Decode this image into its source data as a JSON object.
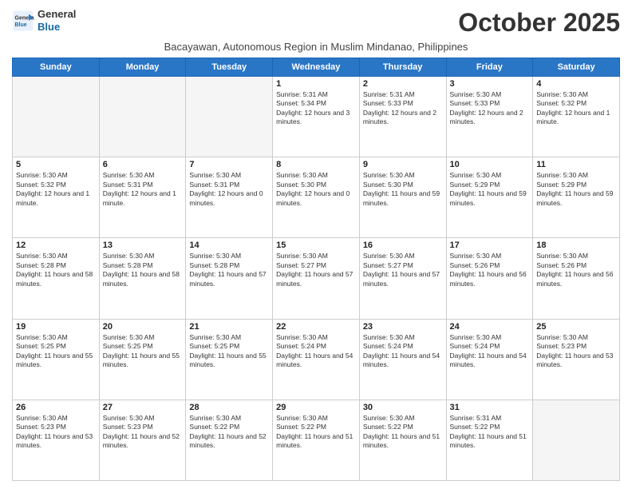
{
  "logo": {
    "line1": "General",
    "line2": "Blue"
  },
  "title": "October 2025",
  "subtitle": "Bacayawan, Autonomous Region in Muslim Mindanao, Philippines",
  "days_of_week": [
    "Sunday",
    "Monday",
    "Tuesday",
    "Wednesday",
    "Thursday",
    "Friday",
    "Saturday"
  ],
  "weeks": [
    [
      {
        "day": "",
        "info": ""
      },
      {
        "day": "",
        "info": ""
      },
      {
        "day": "",
        "info": ""
      },
      {
        "day": "1",
        "info": "Sunrise: 5:31 AM\nSunset: 5:34 PM\nDaylight: 12 hours and 3 minutes."
      },
      {
        "day": "2",
        "info": "Sunrise: 5:31 AM\nSunset: 5:33 PM\nDaylight: 12 hours and 2 minutes."
      },
      {
        "day": "3",
        "info": "Sunrise: 5:30 AM\nSunset: 5:33 PM\nDaylight: 12 hours and 2 minutes."
      },
      {
        "day": "4",
        "info": "Sunrise: 5:30 AM\nSunset: 5:32 PM\nDaylight: 12 hours and 1 minute."
      }
    ],
    [
      {
        "day": "5",
        "info": "Sunrise: 5:30 AM\nSunset: 5:32 PM\nDaylight: 12 hours and 1 minute."
      },
      {
        "day": "6",
        "info": "Sunrise: 5:30 AM\nSunset: 5:31 PM\nDaylight: 12 hours and 1 minute."
      },
      {
        "day": "7",
        "info": "Sunrise: 5:30 AM\nSunset: 5:31 PM\nDaylight: 12 hours and 0 minutes."
      },
      {
        "day": "8",
        "info": "Sunrise: 5:30 AM\nSunset: 5:30 PM\nDaylight: 12 hours and 0 minutes."
      },
      {
        "day": "9",
        "info": "Sunrise: 5:30 AM\nSunset: 5:30 PM\nDaylight: 11 hours and 59 minutes."
      },
      {
        "day": "10",
        "info": "Sunrise: 5:30 AM\nSunset: 5:29 PM\nDaylight: 11 hours and 59 minutes."
      },
      {
        "day": "11",
        "info": "Sunrise: 5:30 AM\nSunset: 5:29 PM\nDaylight: 11 hours and 59 minutes."
      }
    ],
    [
      {
        "day": "12",
        "info": "Sunrise: 5:30 AM\nSunset: 5:28 PM\nDaylight: 11 hours and 58 minutes."
      },
      {
        "day": "13",
        "info": "Sunrise: 5:30 AM\nSunset: 5:28 PM\nDaylight: 11 hours and 58 minutes."
      },
      {
        "day": "14",
        "info": "Sunrise: 5:30 AM\nSunset: 5:28 PM\nDaylight: 11 hours and 57 minutes."
      },
      {
        "day": "15",
        "info": "Sunrise: 5:30 AM\nSunset: 5:27 PM\nDaylight: 11 hours and 57 minutes."
      },
      {
        "day": "16",
        "info": "Sunrise: 5:30 AM\nSunset: 5:27 PM\nDaylight: 11 hours and 57 minutes."
      },
      {
        "day": "17",
        "info": "Sunrise: 5:30 AM\nSunset: 5:26 PM\nDaylight: 11 hours and 56 minutes."
      },
      {
        "day": "18",
        "info": "Sunrise: 5:30 AM\nSunset: 5:26 PM\nDaylight: 11 hours and 56 minutes."
      }
    ],
    [
      {
        "day": "19",
        "info": "Sunrise: 5:30 AM\nSunset: 5:25 PM\nDaylight: 11 hours and 55 minutes."
      },
      {
        "day": "20",
        "info": "Sunrise: 5:30 AM\nSunset: 5:25 PM\nDaylight: 11 hours and 55 minutes."
      },
      {
        "day": "21",
        "info": "Sunrise: 5:30 AM\nSunset: 5:25 PM\nDaylight: 11 hours and 55 minutes."
      },
      {
        "day": "22",
        "info": "Sunrise: 5:30 AM\nSunset: 5:24 PM\nDaylight: 11 hours and 54 minutes."
      },
      {
        "day": "23",
        "info": "Sunrise: 5:30 AM\nSunset: 5:24 PM\nDaylight: 11 hours and 54 minutes."
      },
      {
        "day": "24",
        "info": "Sunrise: 5:30 AM\nSunset: 5:24 PM\nDaylight: 11 hours and 54 minutes."
      },
      {
        "day": "25",
        "info": "Sunrise: 5:30 AM\nSunset: 5:23 PM\nDaylight: 11 hours and 53 minutes."
      }
    ],
    [
      {
        "day": "26",
        "info": "Sunrise: 5:30 AM\nSunset: 5:23 PM\nDaylight: 11 hours and 53 minutes."
      },
      {
        "day": "27",
        "info": "Sunrise: 5:30 AM\nSunset: 5:23 PM\nDaylight: 11 hours and 52 minutes."
      },
      {
        "day": "28",
        "info": "Sunrise: 5:30 AM\nSunset: 5:22 PM\nDaylight: 11 hours and 52 minutes."
      },
      {
        "day": "29",
        "info": "Sunrise: 5:30 AM\nSunset: 5:22 PM\nDaylight: 11 hours and 51 minutes."
      },
      {
        "day": "30",
        "info": "Sunrise: 5:30 AM\nSunset: 5:22 PM\nDaylight: 11 hours and 51 minutes."
      },
      {
        "day": "31",
        "info": "Sunrise: 5:31 AM\nSunset: 5:22 PM\nDaylight: 11 hours and 51 minutes."
      },
      {
        "day": "",
        "info": ""
      }
    ]
  ]
}
